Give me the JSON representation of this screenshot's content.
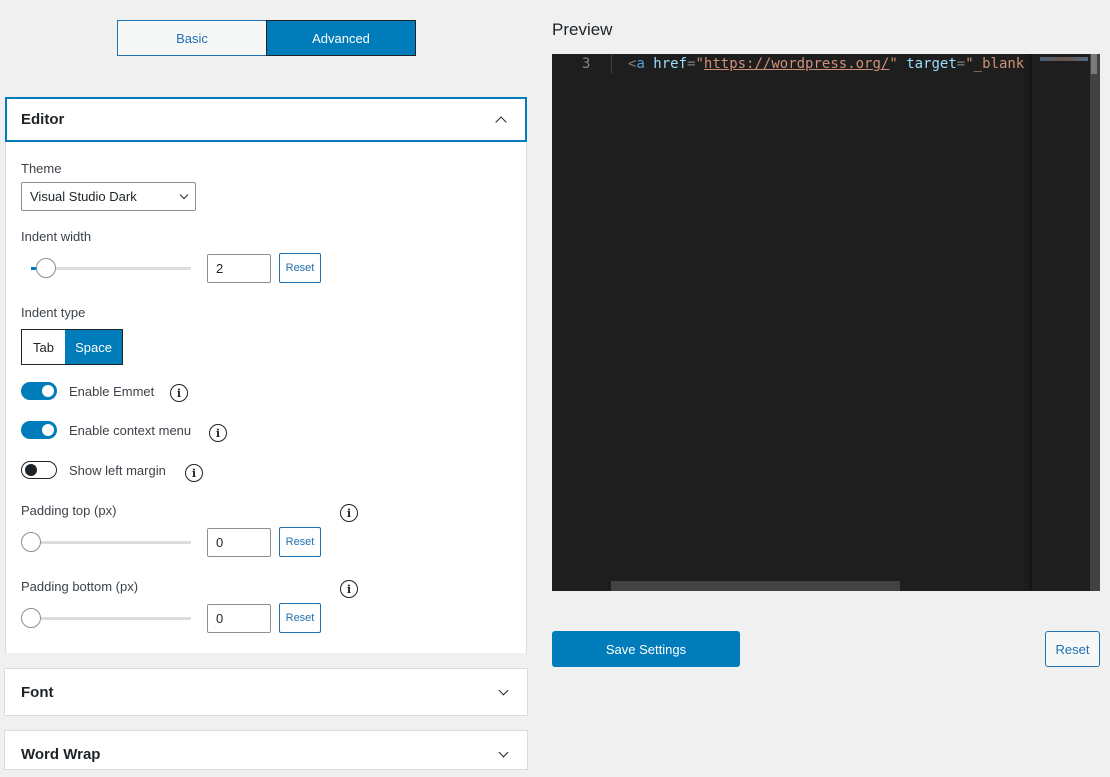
{
  "mode_toggle": {
    "options": [
      "Basic",
      "Advanced"
    ],
    "selected": "Advanced"
  },
  "editor_panel": {
    "title": "Editor",
    "expanded": true,
    "theme": {
      "label": "Theme",
      "value": "Visual Studio Dark"
    },
    "indent_width": {
      "label": "Indent width",
      "value": "2",
      "slider_fraction": 0.1,
      "reset_label": "Reset"
    },
    "indent_type": {
      "label": "Indent type",
      "options": [
        "Tab",
        "Space"
      ],
      "selected": "Space"
    },
    "toggles": [
      {
        "label": "Enable Emmet",
        "on": true
      },
      {
        "label": "Enable context menu",
        "on": true
      },
      {
        "label": "Show left margin",
        "on": false
      }
    ],
    "padding_top": {
      "label": "Padding top (px)",
      "value": "0",
      "slider_fraction": 0,
      "reset_label": "Reset"
    },
    "padding_bottom": {
      "label": "Padding bottom (px)",
      "value": "0",
      "slider_fraction": 0,
      "reset_label": "Reset"
    }
  },
  "collapsed_panels": [
    {
      "title": "Font"
    },
    {
      "title": "Word Wrap"
    }
  ],
  "preview": {
    "title": "Preview",
    "line_number": "3",
    "code": {
      "open": "<",
      "tag": "a",
      "attr1": " href",
      "eq1": "=",
      "q1": "\"",
      "url": "https://wordpress.org/",
      "q2": "\"",
      "attr2": " target",
      "eq2": "=",
      "val2": "\"_blank"
    }
  },
  "actions": {
    "save_label": "Save Settings",
    "reset_label": "Reset"
  },
  "colors": {
    "accent": "#007cba",
    "link": "#2271b1",
    "background": "#f0f0f1",
    "editor_bg": "#1e1e1e"
  }
}
